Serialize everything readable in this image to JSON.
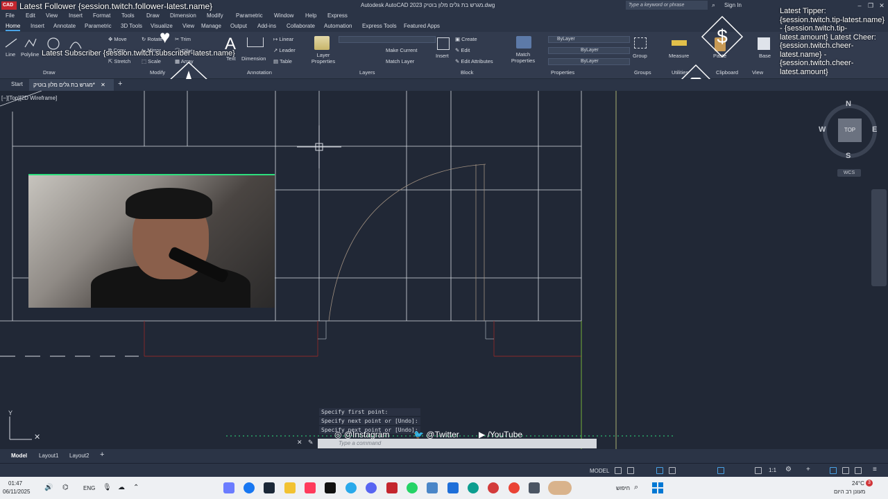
{
  "colors": {
    "accent": "#4aa3e6",
    "drawing_bg": "#212836",
    "ribbon_bg": "#323b4e",
    "overlay_green": "#2de07e",
    "autocad_red": "#c4262e"
  },
  "titlebar": {
    "app_logo": "CAD",
    "title": "Autodesk AutoCAD 2023  מגרש בת גלים מלון בוטיק.dwg",
    "search_placeholder": "Type a keyword or phrase",
    "sign_in": "Sign In"
  },
  "overlays": {
    "follower": "Latest Follower {session.twitch.follower-latest.name}",
    "subscriber": "Latest Subscriber {session.twitch.subscriber-latest.name}",
    "right": "Latest Tipper: {session.twitch.tip-latest.name} - {session.twitch.tip-latest.amount} Latest Cheer: {session.twitch.cheer-latest.name} - {session.twitch.cheer-latest.amount}"
  },
  "menu": [
    "File",
    "Edit",
    "View",
    "Insert",
    "Format",
    "Tools",
    "Draw",
    "Dimension",
    "Modify",
    "Parametric",
    "Window",
    "Help",
    "Express"
  ],
  "ribbon_tabs": [
    "Home",
    "Insert",
    "Annotate",
    "Parametric",
    "3D Tools",
    "Visualize",
    "View",
    "Manage",
    "Output",
    "Add-ins",
    "Collaborate",
    "Automation",
    "Express Tools",
    "Featured Apps"
  ],
  "ribbon": {
    "draw": {
      "line": "Line",
      "polyline": "Polyline",
      "group": "Draw"
    },
    "modify": {
      "move": "Move",
      "rotate": "Rotate",
      "trim": "Trim",
      "copy": "Copy",
      "mirror": "Mirror",
      "fillet": "Fillet",
      "stretch": "Stretch",
      "scale": "Scale",
      "array": "Array",
      "group": "Modify"
    },
    "annotation": {
      "text": "Text",
      "dimension": "Dimension",
      "linear": "Linear",
      "leader": "Leader",
      "table": "Table",
      "group": "Annotation"
    },
    "layers": {
      "layer_properties": "Layer Properties",
      "make_current": "Make Current",
      "match_layer": "Match Layer",
      "group": "Layers"
    },
    "block": {
      "insert": "Insert",
      "create": "Create",
      "edit": "Edit",
      "edit_attributes": "Edit Attributes",
      "group": "Block"
    },
    "properties": {
      "match_properties": "Match Properties",
      "color": "ByLayer",
      "linetype": "ByLayer",
      "lineweight": "ByLayer",
      "group": "Properties"
    },
    "groups": {
      "group_btn": "Group",
      "group": "Groups"
    },
    "utilities": {
      "measure": "Measure",
      "group": "Utilities"
    },
    "clipboard": {
      "paste": "Paste",
      "group": "Clipboard"
    },
    "view": {
      "base": "Base",
      "group": "View"
    }
  },
  "file_tabs": {
    "start": "Start",
    "active": "מגרש בת גלים מלון בוטיק*",
    "add": "+"
  },
  "viewport_label": "[−][Top][2D Wireframe]",
  "viewcube": {
    "top": "TOP",
    "n": "N",
    "s": "S",
    "e": "E",
    "w": "W",
    "wcs": "WCS"
  },
  "command": {
    "history": [
      "Specify first point:",
      "Specify next point or [Undo]:",
      "Specify next point or [Undo]:"
    ],
    "placeholder": "Type a command"
  },
  "socials": {
    "instagram": "@Instagram",
    "twitter": "@Twitter",
    "youtube": "/YouTube"
  },
  "layout_tabs": [
    "Model",
    "Layout1",
    "Layout2"
  ],
  "status": {
    "model": "MODEL",
    "scale": "1:1"
  },
  "taskbar": {
    "time": "01:47",
    "date": "06/11/2025",
    "lang": "ENG",
    "search_label": "חיפוש",
    "weather_temp": "24°C",
    "weather_desc": "מעונן רב היום",
    "badge": "3"
  }
}
